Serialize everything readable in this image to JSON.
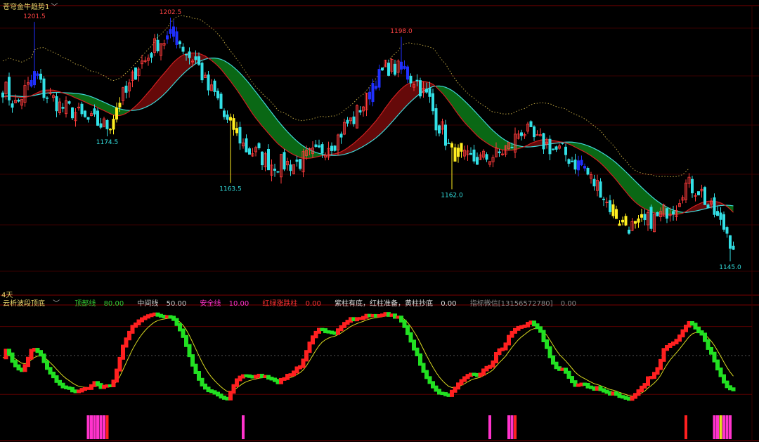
{
  "header": {
    "main_title": "苍穹金牛趋势1",
    "period": "4天",
    "indicator_title": "云析波段顶底",
    "indicator_items": [
      {
        "label": "顶部线",
        "value": "80.00",
        "color": "#33cc33"
      },
      {
        "label": "中间线",
        "value": "50.00",
        "color": "#cccccc"
      },
      {
        "label": "安全线",
        "value": "10.00",
        "color": "#ff33cc"
      },
      {
        "label": "红绿涨跌柱",
        "value": "0.00",
        "color": "#ff3333"
      },
      {
        "label": "紫柱有底，红柱准备，黄柱抄底",
        "value": "0.00",
        "color": "#dddddd"
      },
      {
        "label": "指标微信[13156572780]",
        "value": "0.00",
        "color": "#888888"
      }
    ]
  },
  "chart_data": {
    "type": "candlestick",
    "price_range": [
      1140,
      1205
    ],
    "annotations": [
      {
        "text": "1201.5",
        "index": 10,
        "price": 1201.5,
        "color": "#ff4444",
        "pos": "above"
      },
      {
        "text": "1202.5",
        "index": 53,
        "price": 1202.5,
        "color": "#ff4444",
        "pos": "above"
      },
      {
        "text": "1174.5",
        "index": 33,
        "price": 1174.5,
        "color": "#33dddd",
        "pos": "below"
      },
      {
        "text": "1163.5",
        "index": 72,
        "price": 1163.5,
        "color": "#33dddd",
        "pos": "below"
      },
      {
        "text": "1198.0",
        "index": 126,
        "price": 1198.0,
        "color": "#ff4444",
        "pos": "above"
      },
      {
        "text": "1162.0",
        "index": 142,
        "price": 1162.0,
        "color": "#33dddd",
        "pos": "below"
      },
      {
        "text": "1145.0",
        "index": 230,
        "price": 1145.0,
        "color": "#33dddd",
        "pos": "below"
      }
    ],
    "anchors": [
      [
        0,
        1186
      ],
      [
        4,
        1182
      ],
      [
        8,
        1186
      ],
      [
        10,
        1189
      ],
      [
        14,
        1184
      ],
      [
        20,
        1181
      ],
      [
        28,
        1178
      ],
      [
        33,
        1177
      ],
      [
        38,
        1184
      ],
      [
        44,
        1192
      ],
      [
        50,
        1197
      ],
      [
        54,
        1198
      ],
      [
        60,
        1193
      ],
      [
        66,
        1185
      ],
      [
        72,
        1177
      ],
      [
        78,
        1171
      ],
      [
        86,
        1168
      ],
      [
        92,
        1168
      ],
      [
        98,
        1170
      ],
      [
        104,
        1173
      ],
      [
        110,
        1178
      ],
      [
        114,
        1182
      ],
      [
        118,
        1188
      ],
      [
        122,
        1191
      ],
      [
        126,
        1190
      ],
      [
        130,
        1188
      ],
      [
        134,
        1184
      ],
      [
        138,
        1177
      ],
      [
        142,
        1171
      ],
      [
        146,
        1169
      ],
      [
        150,
        1169
      ],
      [
        156,
        1170
      ],
      [
        160,
        1172
      ],
      [
        164,
        1176
      ],
      [
        170,
        1173
      ],
      [
        176,
        1171
      ],
      [
        182,
        1168
      ],
      [
        188,
        1163
      ],
      [
        192,
        1158
      ],
      [
        196,
        1154
      ],
      [
        200,
        1153
      ],
      [
        206,
        1155
      ],
      [
        212,
        1158
      ],
      [
        216,
        1163
      ],
      [
        220,
        1162
      ],
      [
        224,
        1157
      ],
      [
        228,
        1153
      ],
      [
        231,
        1149
      ]
    ],
    "blue_ranges": [
      [
        9,
        11
      ],
      [
        52,
        55
      ],
      [
        116,
        119
      ],
      [
        126,
        128
      ],
      [
        182,
        184
      ]
    ],
    "yellow_ranges": [
      [
        34,
        37
      ],
      [
        72,
        74
      ],
      [
        142,
        145
      ],
      [
        193,
        197
      ],
      [
        200,
        202
      ]
    ],
    "trend_band": "red when fast above slow, green when below",
    "oscillator": {
      "range": [
        0,
        100
      ],
      "levels": [
        80,
        50,
        10
      ],
      "main_line_rule": "red when rising, green when falling",
      "signal_line_color": "#d8d820",
      "bars": [
        {
          "start": 27,
          "end": 32,
          "color": "#ff33cc"
        },
        {
          "start": 33,
          "end": 33,
          "color": "#ff2020"
        },
        {
          "start": 76,
          "end": 76,
          "color": "#ff33cc"
        },
        {
          "start": 154,
          "end": 154,
          "color": "#ff33cc"
        },
        {
          "start": 160,
          "end": 161,
          "color": "#ff33cc"
        },
        {
          "start": 162,
          "end": 162,
          "color": "#ff2020"
        },
        {
          "start": 216,
          "end": 216,
          "color": "#ff2020"
        },
        {
          "start": 225,
          "end": 226,
          "color": "#ff33cc"
        },
        {
          "start": 227,
          "end": 227,
          "color": "#e8e020"
        },
        {
          "start": 228,
          "end": 230,
          "color": "#ff33cc"
        }
      ]
    }
  }
}
